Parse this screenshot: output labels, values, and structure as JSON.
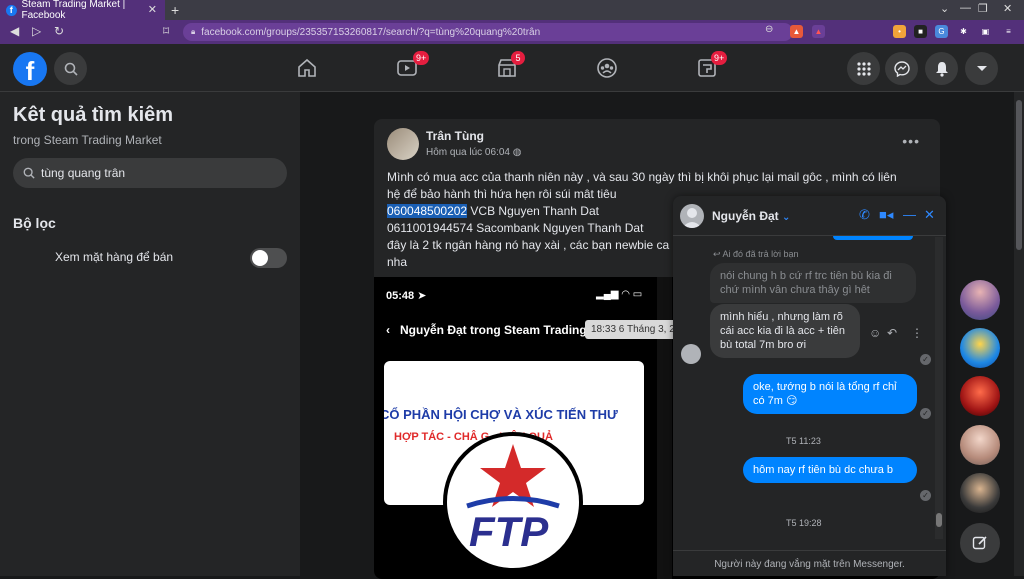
{
  "browser": {
    "tab_title": "Steam Trading Market | Facebook",
    "url": "facebook.com/groups/235357153260817/search/?q=tùng%20quang%20trân"
  },
  "fb_nav": {
    "video_badge": "9+",
    "marketplace_badge": "5",
    "gaming_badge": "9+"
  },
  "sidebar": {
    "title": "Kêt quả tìm kiêm",
    "subtitle": "trong Steam Trading Market",
    "search_value": "tùng quang trân",
    "filter_heading": "Bộ lọc",
    "filter_option": "Xem mặt hàng để bán",
    "filter_enabled": false
  },
  "post": {
    "author": "Trân Tùng",
    "time": "Hôm qua lúc 06:04",
    "line1": "Mình có mua acc của thanh niên này , và sau 30 ngày thì bị khôi phục lại mail gôc , mình có liên",
    "line2": "hệ để bảo hành thì hứa hẹn rôi súi mât tiêu",
    "account_highlight": "060048500202",
    "account_rest": " VCB Nguyen Thanh Dat",
    "line4": "0611001944574 Sacombank Nguyen Thanh Dat",
    "line5": "đây là 2 tk ngân hàng nó hay xài , các bạn newbie ca",
    "line6": "nha",
    "image": {
      "status_time": "05:48",
      "title": "Nguyễn Đạt trong Steam Trading",
      "banner_line1": "CỔ PHẦN HỘI CHỢ VÀ XÚC TIẾN THƯ",
      "banner_line2": "HỢP TÁC - CHÂ     G - HIỆU QUẢ",
      "logo_text": "FTP"
    },
    "tooltip": "18:33 6 Tháng 3, 2022"
  },
  "chat": {
    "name": "Nguyễn Đạt",
    "reply_note": "Ai đó đã trả lời bạn",
    "reply_quote": "nói chung h b cứ rf trc tiên bù kia đi chứ mình vân chưa thây gì hêt",
    "msg1": "mình hiểu , nhưng làm rõ cái acc kia đi là acc + tiên bù total 7m bro ơi",
    "msg2": "oke, tướng b nói là tổng rf chỉ có 7m",
    "time1": "T5 11:23",
    "msg3": "hôm nay rf tiên bù dc chưa b",
    "time2": "T5 19:28",
    "footer": "Người này đang vắng mặt trên Messenger."
  },
  "colors": {
    "fb_blue": "#1877f2",
    "messenger_blue": "#0084ff",
    "browser_purple": "#53307a"
  }
}
